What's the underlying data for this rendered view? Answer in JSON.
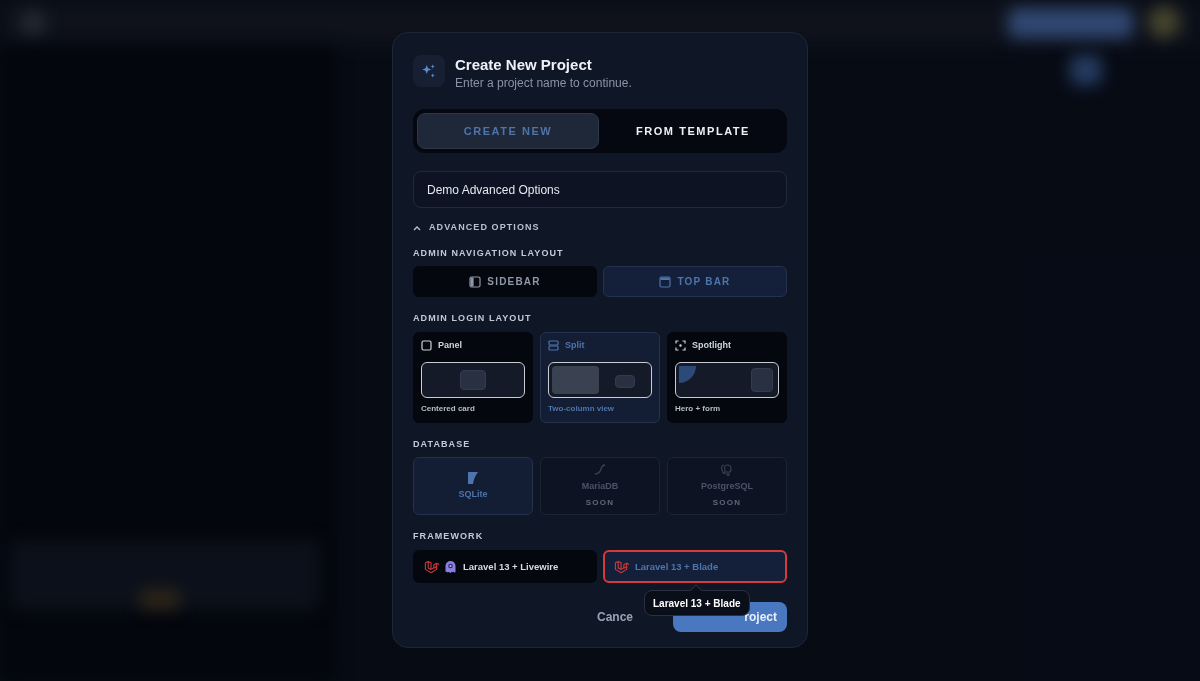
{
  "dialog": {
    "title": "Create New Project",
    "subtitle": "Enter a project name to continue."
  },
  "tabs": [
    {
      "label": "CREATE NEW",
      "selected": true
    },
    {
      "label": "FROM TEMPLATE",
      "selected": false
    }
  ],
  "project_name": {
    "value": "Demo Advanced Options"
  },
  "advanced_options": {
    "label": "ADVANCED OPTIONS",
    "expanded": true
  },
  "navigation_layout": {
    "label": "ADMIN NAVIGATION LAYOUT",
    "options": [
      {
        "kind": "sidebar",
        "label": "SIDEBAR",
        "selected": false
      },
      {
        "kind": "topbar",
        "label": "TOP BAR",
        "selected": true
      }
    ]
  },
  "login_layout": {
    "label": "ADMIN LOGIN LAYOUT",
    "options": [
      {
        "kind": "panel",
        "label": "Panel",
        "caption": "Centered card",
        "selected": false
      },
      {
        "kind": "split",
        "label": "Split",
        "caption": "Two-column view",
        "selected": true
      },
      {
        "kind": "spotlight",
        "label": "Spotlight",
        "caption": "Hero + form",
        "selected": false
      }
    ]
  },
  "database": {
    "label": "DATABASE",
    "options": [
      {
        "kind": "sqlite",
        "label": "SQLite",
        "selected": true,
        "disabled": false
      },
      {
        "kind": "mariadb",
        "label": "MariaDB",
        "badge": "SOON",
        "selected": false,
        "disabled": true
      },
      {
        "kind": "postgresql",
        "label": "PostgreSQL",
        "badge": "SOON",
        "selected": false,
        "disabled": true
      }
    ]
  },
  "framework": {
    "label": "FRAMEWORK",
    "options": [
      {
        "kind": "livewire",
        "label": "Laravel 13 + Livewire",
        "selected": false,
        "focused": false
      },
      {
        "kind": "blade",
        "label": "Laravel 13 + Blade",
        "selected": true,
        "focused": true
      }
    ]
  },
  "tooltip": {
    "text": "Laravel 13 + Blade"
  },
  "buttons": {
    "cancel": "Cance",
    "create": "roject"
  }
}
